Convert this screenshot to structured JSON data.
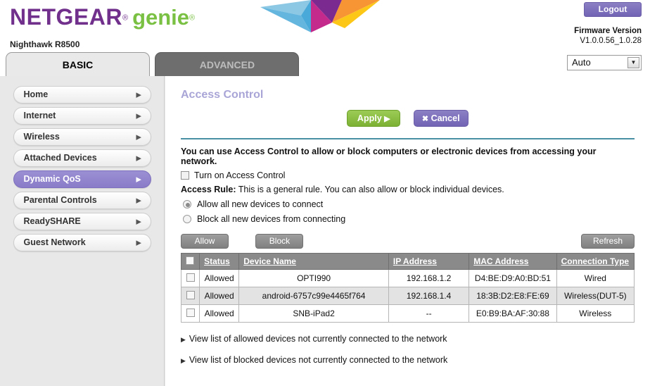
{
  "header": {
    "brand_netgear": "NETGEAR",
    "brand_reg": "®",
    "brand_genie": "genie",
    "brand_genie_reg": "®",
    "model": "Nighthawk R8500",
    "logout_label": "Logout",
    "firmware_label": "Firmware Version",
    "firmware_value": "V1.0.0.56_1.0.28",
    "language_selected": "Auto",
    "colors": {
      "netgear_purple": "#70308c",
      "genie_green": "#7ac143",
      "logout_purple": "#7264b4"
    }
  },
  "tabs": [
    {
      "label": "BASIC",
      "active": true
    },
    {
      "label": "ADVANCED",
      "active": false
    }
  ],
  "sidebar": {
    "items": [
      {
        "label": "Home",
        "active": false
      },
      {
        "label": "Internet",
        "active": false
      },
      {
        "label": "Wireless",
        "active": false
      },
      {
        "label": "Attached Devices",
        "active": false
      },
      {
        "label": "Dynamic QoS",
        "active": true
      },
      {
        "label": "Parental Controls",
        "active": false
      },
      {
        "label": "ReadySHARE",
        "active": false
      },
      {
        "label": "Guest Network",
        "active": false
      }
    ]
  },
  "main": {
    "page_title": "Access Control",
    "apply_label": "Apply",
    "apply_glyph": "▶",
    "cancel_label": "Cancel",
    "cancel_glyph": "✖",
    "intro_text": "You can use Access Control to allow or block computers or electronic devices from accessing your network.",
    "enable_checkbox_label": "Turn on Access Control",
    "enable_checkbox_checked": false,
    "access_rule_bold": "Access Rule:",
    "access_rule_text": " This is a general rule. You can also allow or block individual devices.",
    "radios": [
      {
        "label": "Allow all new devices to connect",
        "checked": true
      },
      {
        "label": "Block all new devices from connecting",
        "checked": false
      }
    ],
    "allow_button": "Allow",
    "block_button": "Block",
    "refresh_button": "Refresh",
    "table": {
      "headers": [
        "Status",
        "Device Name",
        "IP Address",
        "MAC Address",
        "Connection Type"
      ],
      "rows": [
        {
          "status": "Allowed",
          "device_name": "OPTI990",
          "ip_address": "192.168.1.2",
          "mac_address": "D4:BE:D9:A0:BD:51",
          "connection_type": "Wired"
        },
        {
          "status": "Allowed",
          "device_name": "android-6757c99e4465f764",
          "ip_address": "192.168.1.4",
          "mac_address": "18:3B:D2:E8:FE:69",
          "connection_type": "Wireless(DUT-5)"
        },
        {
          "status": "Allowed",
          "device_name": "SNB-iPad2",
          "ip_address": "--",
          "mac_address": "E0:B9:BA:AF:30:88",
          "connection_type": "Wireless"
        }
      ]
    },
    "expand_links": [
      "View list of allowed devices not currently connected to the network",
      "View list of blocked devices not currently connected to the network"
    ]
  }
}
